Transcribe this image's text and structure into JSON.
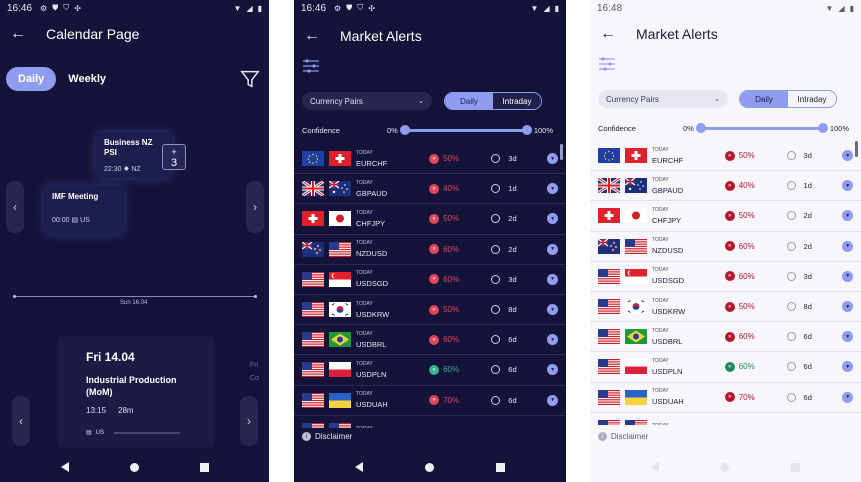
{
  "screen1": {
    "status_time": "16:46",
    "title": "Calendar Page",
    "tabs": [
      "Daily",
      "Weekly"
    ],
    "events": [
      {
        "name": "Business NZ PSI",
        "time": "22:30",
        "country": "NZ"
      },
      {
        "name": "IMF Meeting",
        "time": "00:00",
        "country": "US"
      }
    ],
    "plus_badge": {
      "sign": "+",
      "count": "3"
    },
    "axis_label": "Sun 16.04",
    "detail": {
      "date": "Fri 14.04",
      "event": "Industrial Production (MoM)",
      "time": "13:15",
      "duration": "28m",
      "country": "US"
    },
    "partial_card": {
      "line1": "Fri",
      "line2": "Co"
    }
  },
  "screen2": {
    "status_time": "16:46",
    "title": "Market Alerts",
    "select_label": "Currency Pairs",
    "segments": [
      "Daily",
      "Intraday"
    ],
    "confidence_label": "Confidence",
    "conf_min": "0%",
    "conf_max": "100%",
    "disclaimer": "Disclaimer"
  },
  "screen3": {
    "status_time": "16:48",
    "title": "Market Alerts",
    "select_label": "Currency Pairs",
    "segments": [
      "Daily",
      "Intraday"
    ],
    "confidence_label": "Confidence",
    "conf_min": "0%",
    "conf_max": "100%",
    "disclaimer": "Disclaimer"
  },
  "alerts": [
    {
      "today": "TODAY",
      "pair": "EURCHF",
      "pct": "50%",
      "dir": "down",
      "dur": "3d"
    },
    {
      "today": "TODAY",
      "pair": "GBPAUD",
      "pct": "40%",
      "dir": "down",
      "dur": "1d"
    },
    {
      "today": "TODAY",
      "pair": "CHFJPY",
      "pct": "50%",
      "dir": "down",
      "dur": "2d"
    },
    {
      "today": "TODAY",
      "pair": "NZDUSD",
      "pct": "60%",
      "dir": "down",
      "dur": "2d"
    },
    {
      "today": "TODAY",
      "pair": "USDSGD",
      "pct": "60%",
      "dir": "down",
      "dur": "3d"
    },
    {
      "today": "TODAY",
      "pair": "USDKRW",
      "pct": "50%",
      "dir": "down",
      "dur": "8d"
    },
    {
      "today": "TODAY",
      "pair": "USDBRL",
      "pct": "60%",
      "dir": "down",
      "dur": "6d"
    },
    {
      "today": "TODAY",
      "pair": "USDPLN",
      "pct": "60%",
      "dir": "up",
      "dur": "6d"
    },
    {
      "today": "TODAY",
      "pair": "USDUAH",
      "pct": "70%",
      "dir": "down",
      "dur": "6d"
    },
    {
      "today": "TODAY",
      "pair": "",
      "pct": "",
      "dir": "down",
      "dur": ""
    }
  ],
  "colors": {
    "accent": "#8f9cf0",
    "down": "#e0465a",
    "down_light": "#b5162e",
    "up": "#38b48a",
    "up_light": "#1f8a5a"
  }
}
